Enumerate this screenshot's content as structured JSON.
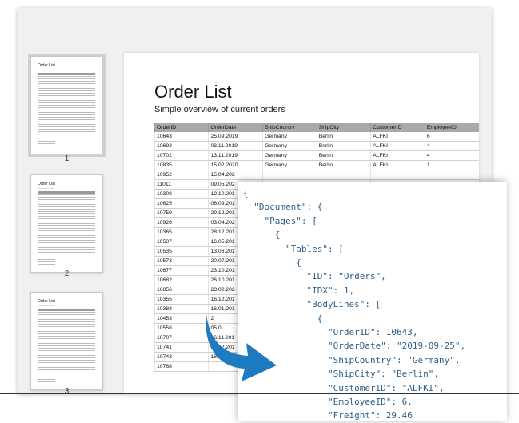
{
  "document": {
    "title": "Order List",
    "subtitle": "Simple overview of current orders"
  },
  "thumbnails": [
    {
      "page": "1",
      "title": "Order List"
    },
    {
      "page": "2",
      "title": "Order List"
    },
    {
      "page": "3",
      "title": "Order List"
    }
  ],
  "table": {
    "columns": [
      "OrderID",
      "OrderDate",
      "ShipCountry",
      "ShipCity",
      "CustomerID",
      "EmployeeID"
    ],
    "rows": [
      [
        "10643",
        "25.09.2019",
        "Germany",
        "Berlin",
        "ALFKI",
        "6"
      ],
      [
        "10692",
        "03.11.2019",
        "Germany",
        "Berlin",
        "ALFKI",
        "4"
      ],
      [
        "10702",
        "13.11.2019",
        "Germany",
        "Berlin",
        "ALFKI",
        "4"
      ],
      [
        "10835",
        "15.02.2020",
        "Germany",
        "Berlin",
        "ALFKI",
        "1"
      ],
      [
        "10952",
        "15.04.202",
        "",
        "",
        "",
        ""
      ],
      [
        "11011",
        "09.05.202",
        "",
        "",
        "",
        ""
      ],
      [
        "10308",
        "19.10.201",
        "",
        "",
        "",
        ""
      ],
      [
        "10625",
        "08.09.201",
        "",
        "",
        "",
        ""
      ],
      [
        "10759",
        "29.12.201",
        "",
        "",
        "",
        ""
      ],
      [
        "10926",
        "03.04.202",
        "",
        "",
        "",
        ""
      ],
      [
        "10365",
        "28.12.201",
        "",
        "",
        "",
        ""
      ],
      [
        "10507",
        "16.05.201",
        "",
        "",
        "",
        ""
      ],
      [
        "10535",
        "13.06.201",
        "",
        "",
        "",
        ""
      ],
      [
        "10573",
        "20.07.201",
        "",
        "",
        "",
        ""
      ],
      [
        "10677",
        "23.10.201",
        "",
        "",
        "",
        ""
      ],
      [
        "10682",
        "26.10.201",
        "",
        "",
        "",
        ""
      ],
      [
        "10856",
        "28.02.202",
        "",
        "",
        "",
        ""
      ],
      [
        "10355",
        "16.12.201",
        "",
        "",
        "",
        ""
      ],
      [
        "10383",
        "16.01.201",
        "",
        "",
        "",
        ""
      ],
      [
        "10453",
        "2",
        "",
        "",
        "",
        ""
      ],
      [
        "10558",
        "05.0",
        "",
        "",
        "",
        ""
      ],
      [
        "10707",
        "16.11.201",
        "",
        "",
        "",
        ""
      ],
      [
        "10741",
        "15.12.201",
        "",
        "",
        "",
        ""
      ],
      [
        "10743",
        "18.12.201",
        "",
        "",
        "",
        ""
      ],
      [
        "10768",
        "",
        "",
        "",
        "",
        ""
      ]
    ]
  },
  "json_lines": [
    "{",
    "  \"Document\": {",
    "    \"Pages\": [",
    "      {",
    "        \"Tables\": [",
    "          {",
    "            \"ID\": \"Orders\",",
    "            \"IDX\": 1,",
    "            \"BodyLines\": [",
    "              {",
    "                \"OrderID\": 10643,",
    "                \"OrderDate\": \"2019-09-25\",",
    "                \"ShipCountry\": \"Germany\",",
    "                \"ShipCity\": \"Berlin\",",
    "                \"CustomerID\": \"ALFKI\",",
    "                \"EmployeeID\": 6,",
    "                \"Freight\": 29.46"
  ],
  "colors": {
    "arrow": "#1f7bc1",
    "header": "#a9a9a9",
    "json_text": "#2b5f8a"
  }
}
